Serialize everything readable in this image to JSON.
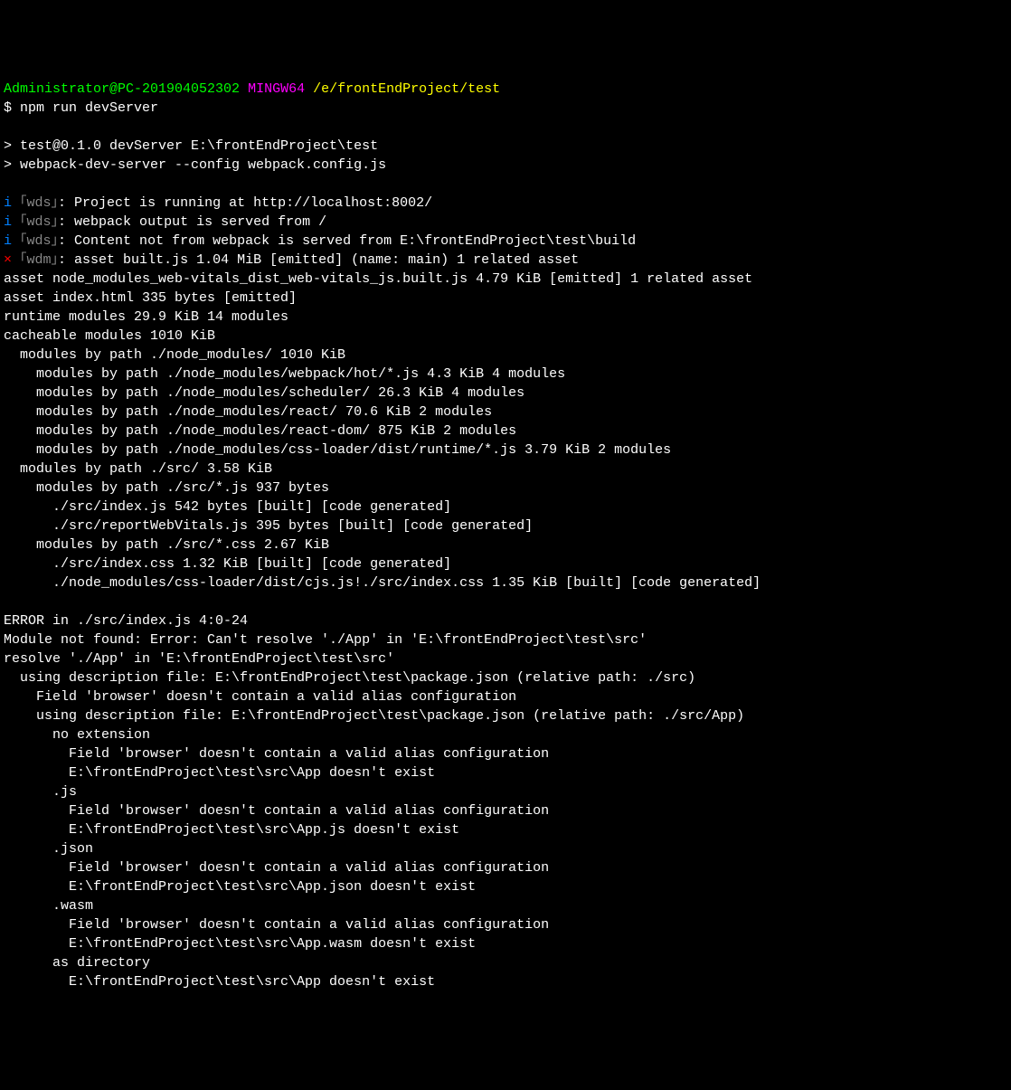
{
  "prompt": {
    "user": "Administrator@PC-201904052302",
    "env": "MINGW64",
    "path": "/e/frontEndProject/test",
    "symbol": "$",
    "command": "npm run devServer"
  },
  "header": {
    "line1": "> test@0.1.0 devServer E:\\frontEndProject\\test",
    "line2": "> webpack-dev-server --config webpack.config.js"
  },
  "wds": {
    "prefix": "｢wds｣",
    "wdm_prefix": "｢wdm｣",
    "i": "i",
    "x": "×",
    "l1": ": Project is running at http://localhost:8002/",
    "l2": ": webpack output is served from /",
    "l3": ": Content not from webpack is served from E:\\frontEndProject\\test\\build",
    "l4": ": asset built.js 1.04 MiB [emitted] (name: main) 1 related asset"
  },
  "assets": {
    "a1": "asset node_modules_web-vitals_dist_web-vitals_js.built.js 4.79 KiB [emitted] 1 related asset",
    "a2": "asset index.html 335 bytes [emitted]",
    "a3": "runtime modules 29.9 KiB 14 modules",
    "a4": "cacheable modules 1010 KiB"
  },
  "modules": {
    "m1": "  modules by path ./node_modules/ 1010 KiB",
    "m2": "    modules by path ./node_modules/webpack/hot/*.js 4.3 KiB 4 modules",
    "m3": "    modules by path ./node_modules/scheduler/ 26.3 KiB 4 modules",
    "m4": "    modules by path ./node_modules/react/ 70.6 KiB 2 modules",
    "m5": "    modules by path ./node_modules/react-dom/ 875 KiB 2 modules",
    "m6": "    modules by path ./node_modules/css-loader/dist/runtime/*.js 3.79 KiB 2 modules",
    "m7": "  modules by path ./src/ 3.58 KiB",
    "m8": "    modules by path ./src/*.js 937 bytes",
    "m9": "      ./src/index.js 542 bytes [built] [code generated]",
    "m10": "      ./src/reportWebVitals.js 395 bytes [built] [code generated]",
    "m11": "    modules by path ./src/*.css 2.67 KiB",
    "m12": "      ./src/index.css 1.32 KiB [built] [code generated]",
    "m13": "      ./node_modules/css-loader/dist/cjs.js!./src/index.css 1.35 KiB [built] [code generated]"
  },
  "error": {
    "e1": "ERROR in ./src/index.js 4:0-24",
    "e2": "Module not found: Error: Can't resolve './App' in 'E:\\frontEndProject\\test\\src'",
    "e3": "resolve './App' in 'E:\\frontEndProject\\test\\src'",
    "e4": "  using description file: E:\\frontEndProject\\test\\package.json (relative path: ./src)",
    "e5": "    Field 'browser' doesn't contain a valid alias configuration",
    "e6": "    using description file: E:\\frontEndProject\\test\\package.json (relative path: ./src/App)",
    "e7": "      no extension",
    "e8": "        Field 'browser' doesn't contain a valid alias configuration",
    "e9": "        E:\\frontEndProject\\test\\src\\App doesn't exist",
    "e10": "      .js",
    "e11": "        Field 'browser' doesn't contain a valid alias configuration",
    "e12": "        E:\\frontEndProject\\test\\src\\App.js doesn't exist",
    "e13": "      .json",
    "e14": "        Field 'browser' doesn't contain a valid alias configuration",
    "e15": "        E:\\frontEndProject\\test\\src\\App.json doesn't exist",
    "e16": "      .wasm",
    "e17": "        Field 'browser' doesn't contain a valid alias configuration",
    "e18": "        E:\\frontEndProject\\test\\src\\App.wasm doesn't exist",
    "e19": "      as directory",
    "e20": "        E:\\frontEndProject\\test\\src\\App doesn't exist"
  }
}
